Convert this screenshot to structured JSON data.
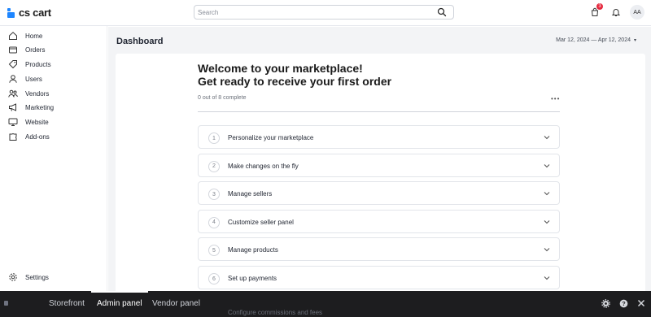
{
  "app": {
    "logo_text": "cs cart"
  },
  "search": {
    "placeholder": "Search",
    "value": ""
  },
  "header": {
    "notifications_count": "3",
    "avatar_initials": "AA"
  },
  "sidebar": {
    "items": [
      {
        "label": "Home",
        "icon": "home-icon"
      },
      {
        "label": "Orders",
        "icon": "orders-icon"
      },
      {
        "label": "Products",
        "icon": "tag-icon"
      },
      {
        "label": "Users",
        "icon": "user-icon"
      },
      {
        "label": "Vendors",
        "icon": "vendors-icon"
      },
      {
        "label": "Marketing",
        "icon": "megaphone-icon"
      },
      {
        "label": "Website",
        "icon": "monitor-icon"
      },
      {
        "label": "Add-ons",
        "icon": "puzzle-icon"
      }
    ],
    "settings_label": "Settings"
  },
  "main": {
    "page_title": "Dashboard",
    "date_range": "Mar 12, 2024 — Apr 12, 2024"
  },
  "welcome": {
    "title": "Welcome to your marketplace!",
    "subtitle": "Get ready to receive your first order",
    "progress_text": "0 out of 8 complete",
    "progress_fraction": 0
  },
  "steps": [
    {
      "num": "1",
      "label": "Personalize your marketplace"
    },
    {
      "num": "2",
      "label": "Make changes on the fly"
    },
    {
      "num": "3",
      "label": "Manage sellers"
    },
    {
      "num": "4",
      "label": "Customize seller panel"
    },
    {
      "num": "5",
      "label": "Manage products"
    },
    {
      "num": "6",
      "label": "Set up payments"
    }
  ],
  "bottom_bar": {
    "tabs": [
      {
        "label": "Storefront",
        "active": false
      },
      {
        "label": "Admin panel",
        "active": true
      },
      {
        "label": "Vendor panel",
        "active": false
      }
    ],
    "peek_text": "Configure commissions and fees"
  },
  "colors": {
    "accent": "#1e86ff",
    "badge": "#e5273d",
    "bottom_bar": "#1d1d1f",
    "main_bg": "#f3f4f6"
  }
}
